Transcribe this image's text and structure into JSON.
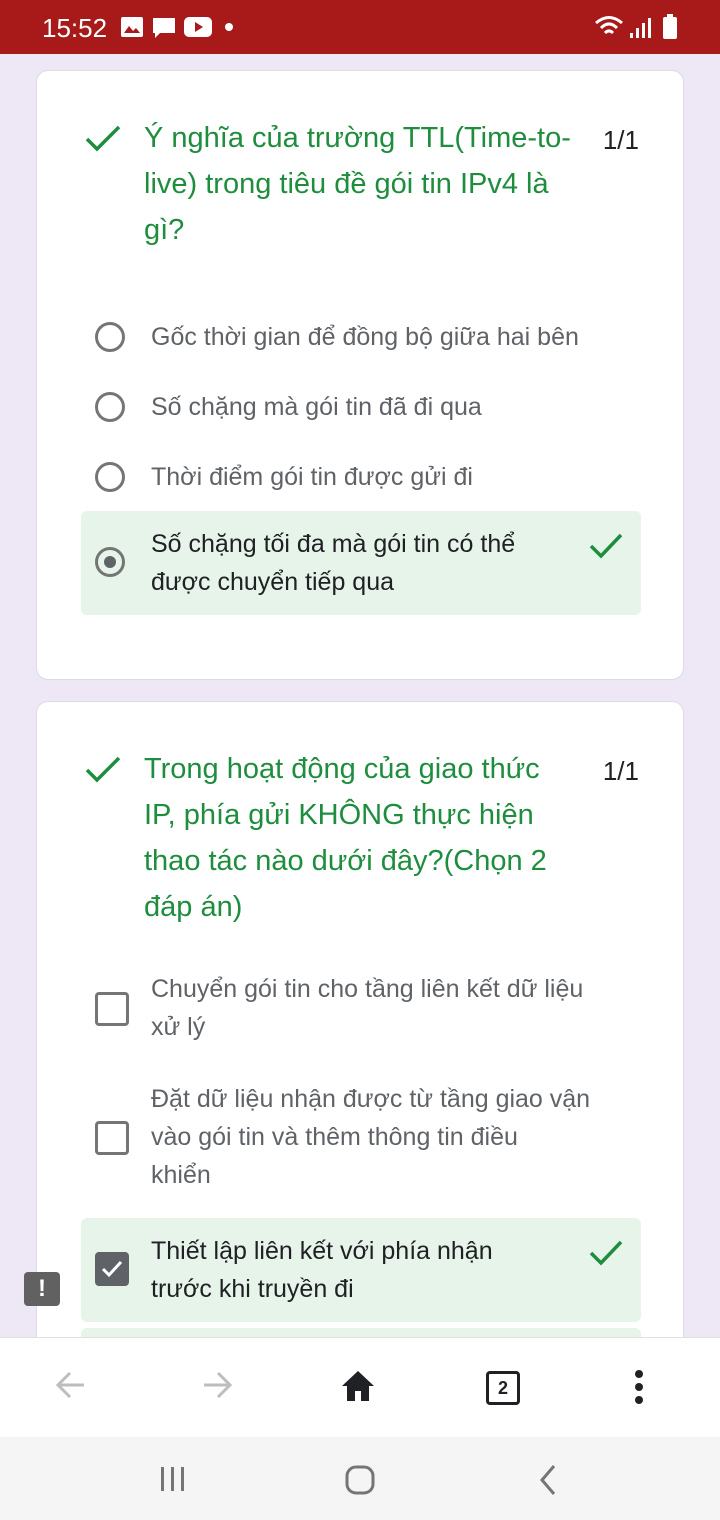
{
  "status_bar": {
    "time": "15:52",
    "bg_color": "#a8191a",
    "icons": [
      "gallery-icon",
      "message-icon",
      "youtube-icon",
      "dot-icon",
      "wifi-icon",
      "signal-icon",
      "battery-icon"
    ]
  },
  "questions": [
    {
      "title": "Ý nghĩa của trường TTL(Time-to-live) trong tiêu đề gói tin IPv4 là gì?",
      "title_lines": [
        "Ý nghĩa của trường TTL(Time-to-",
        "live) trong tiêu đề gói tin IPv4 là",
        "gì?"
      ],
      "score": "1/1",
      "options": [
        {
          "lines": [
            "Gốc thời gian để đồng bộ giữa hai bên"
          ],
          "selected": false
        },
        {
          "lines": [
            "Số chặng mà gói tin đã đi qua"
          ],
          "selected": false
        },
        {
          "lines": [
            "Thời điểm gói tin được gửi đi"
          ],
          "selected": false
        },
        {
          "lines": [
            "Số chặng tối đa mà gói tin có thể",
            "được chuyển tiếp qua"
          ],
          "selected": true,
          "correct": true
        }
      ]
    },
    {
      "title": "Trong hoạt động của giao thức IP, phía gửi KHÔNG thực hiện thao tác nào dưới đây?(Chọn 2 đáp án)",
      "title_lines": [
        "Trong hoạt động của giao thức",
        "IP, phía gửi KHÔNG thực hiện",
        "thao tác nào dưới đây?(Chọn 2",
        "đáp án)"
      ],
      "score": "1/1",
      "options": [
        {
          "lines": [
            "Chuyển gói tin cho tầng liên kết dữ liệu",
            "xử lý"
          ],
          "selected": false
        },
        {
          "lines": [
            "Đặt dữ liệu nhận được từ tầng giao vận",
            "vào gói tin và thêm thông tin điều",
            "khiển"
          ],
          "selected": false
        },
        {
          "lines": [
            "Thiết lập liên kết với phía nhận",
            "trước khi truyền đi"
          ],
          "selected": true,
          "correct": true
        }
      ]
    }
  ],
  "feedback_button": {
    "label": "!"
  },
  "toolbar": {
    "tabs_count": "2"
  },
  "colors": {
    "correct_green": "#1e8e3e",
    "correct_bg": "#e6f4ea",
    "page_bg": "#ede7f6"
  }
}
